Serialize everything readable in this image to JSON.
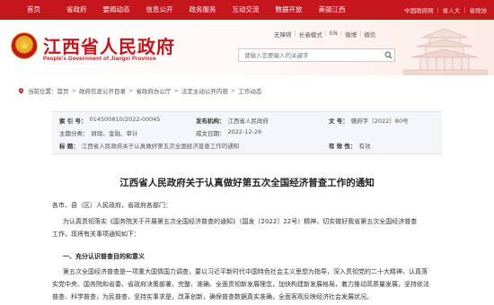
{
  "topnav": {
    "items": [
      "首页",
      "省政府",
      "要闻动态",
      "信息公开",
      "政务服务",
      "互动交流",
      "数据开放",
      "美丽江西"
    ],
    "right": {
      "link1": "中国政府网",
      "sep1": "|",
      "link2": "省人大",
      "sep2": "|",
      "link3": "省政协"
    }
  },
  "header": {
    "title": "江西省人民政府",
    "subtitle": "People's Government of Jiangxi Province",
    "utility": {
      "barrier_free": "无障碍",
      "sep1": "|",
      "elder": "长者模式",
      "sep2": "|",
      "en": "EN",
      "sep3": "|",
      "weibo": "微博",
      "sep4": "|",
      "wechat": "微信"
    },
    "search_placeholder": "请输入您要输入的关键字"
  },
  "breadcrumb": {
    "prefix": "当前位置：",
    "items": [
      "首页",
      "政府信息公开目录",
      "省政府办公厅",
      "法定主动公开内容",
      "工作动态"
    ],
    "separator": ">"
  },
  "meta": {
    "index_label": "索 引 号：",
    "index_value": "014500810/2022-00045",
    "issuer_label": "发布机构：",
    "issuer_value": "江西省人民政府",
    "docno_label": "文 号：",
    "docno_value": "赣府字〔2022〕80号",
    "category_label": "主题分类：",
    "category_value": "财政、金融、审计",
    "date_label": "成文日期：",
    "date_value": "2022-12-26",
    "title_label": "标  题：",
    "title_value": "江西省人民政府关于认真做好第五次全国经济普查工作的通知",
    "validity_label": "有 效 性：",
    "validity_value": "有效"
  },
  "article": {
    "title": "江西省人民政府关于认真做好第五次全国经济普查工作的通知",
    "salutation": "各市、县（区）人民政府，省政府各部门：",
    "para1_line1": "为认真贯彻落实《国务院关于开展第五次全国经济普查的通知》（国发〔2022〕22号）精神，切实做好我省第五次全国经济普查",
    "para1_line2": "工作，现将有关事项通知如下：",
    "heading1": "一、充分认识普查目的和意义",
    "para2_line1": "第五次全国经济普查是一项重大国情国力调查，要以习近平新时代中国特色社会主义思想为指导，深入贯彻党的二十大精神，认真落",
    "para2_line2": "实党中央、国务院和省委、省政府决策部署，完整、准确、全面贯彻新发展理念，加快构建新发展格局，着力推动高质量发展，坚持依法",
    "para2_line3": "普查、科学普查，为民普查，坚持实事求是，改革创新，确保普查数据真实准确，全面客观反映经济社会发展状况。"
  },
  "colors": {
    "brand_red": "#c4161c",
    "meta_bg": "#f4f6f9"
  }
}
